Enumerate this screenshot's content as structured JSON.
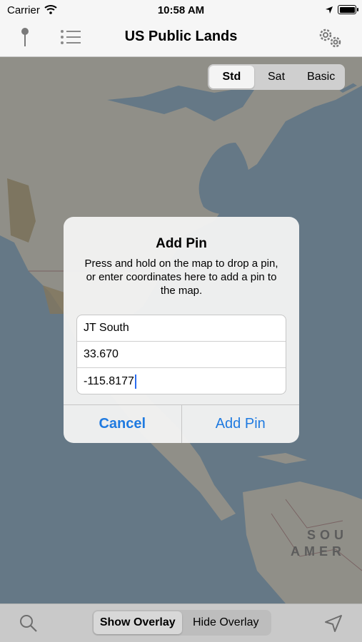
{
  "status_bar": {
    "carrier": "Carrier",
    "time": "10:58 AM"
  },
  "nav": {
    "title": "US Public Lands",
    "icons": [
      "pin-icon",
      "list-icon",
      "settings-gears-icon"
    ]
  },
  "map_type": {
    "options": [
      "Std",
      "Sat",
      "Basic"
    ],
    "selected": "Std"
  },
  "map_labels": {
    "continent_line1": "SOU",
    "continent_line2": "AMER"
  },
  "dialog": {
    "title": "Add Pin",
    "message": "Press and hold on the map to drop a pin, or enter coordinates here to add a pin to the map.",
    "fields": [
      {
        "name": "pin-name-field",
        "value": "JT South"
      },
      {
        "name": "latitude-field",
        "value": "33.670"
      },
      {
        "name": "longitude-field",
        "value": "-115.8177"
      }
    ],
    "cancel_label": "Cancel",
    "confirm_label": "Add Pin"
  },
  "toolbar": {
    "overlay_options": [
      "Show Overlay",
      "Hide Overlay"
    ],
    "selected": "Show Overlay"
  },
  "colors": {
    "accent": "#1f7ae0",
    "water": "#a9c8df",
    "land": "#f1efe3"
  }
}
